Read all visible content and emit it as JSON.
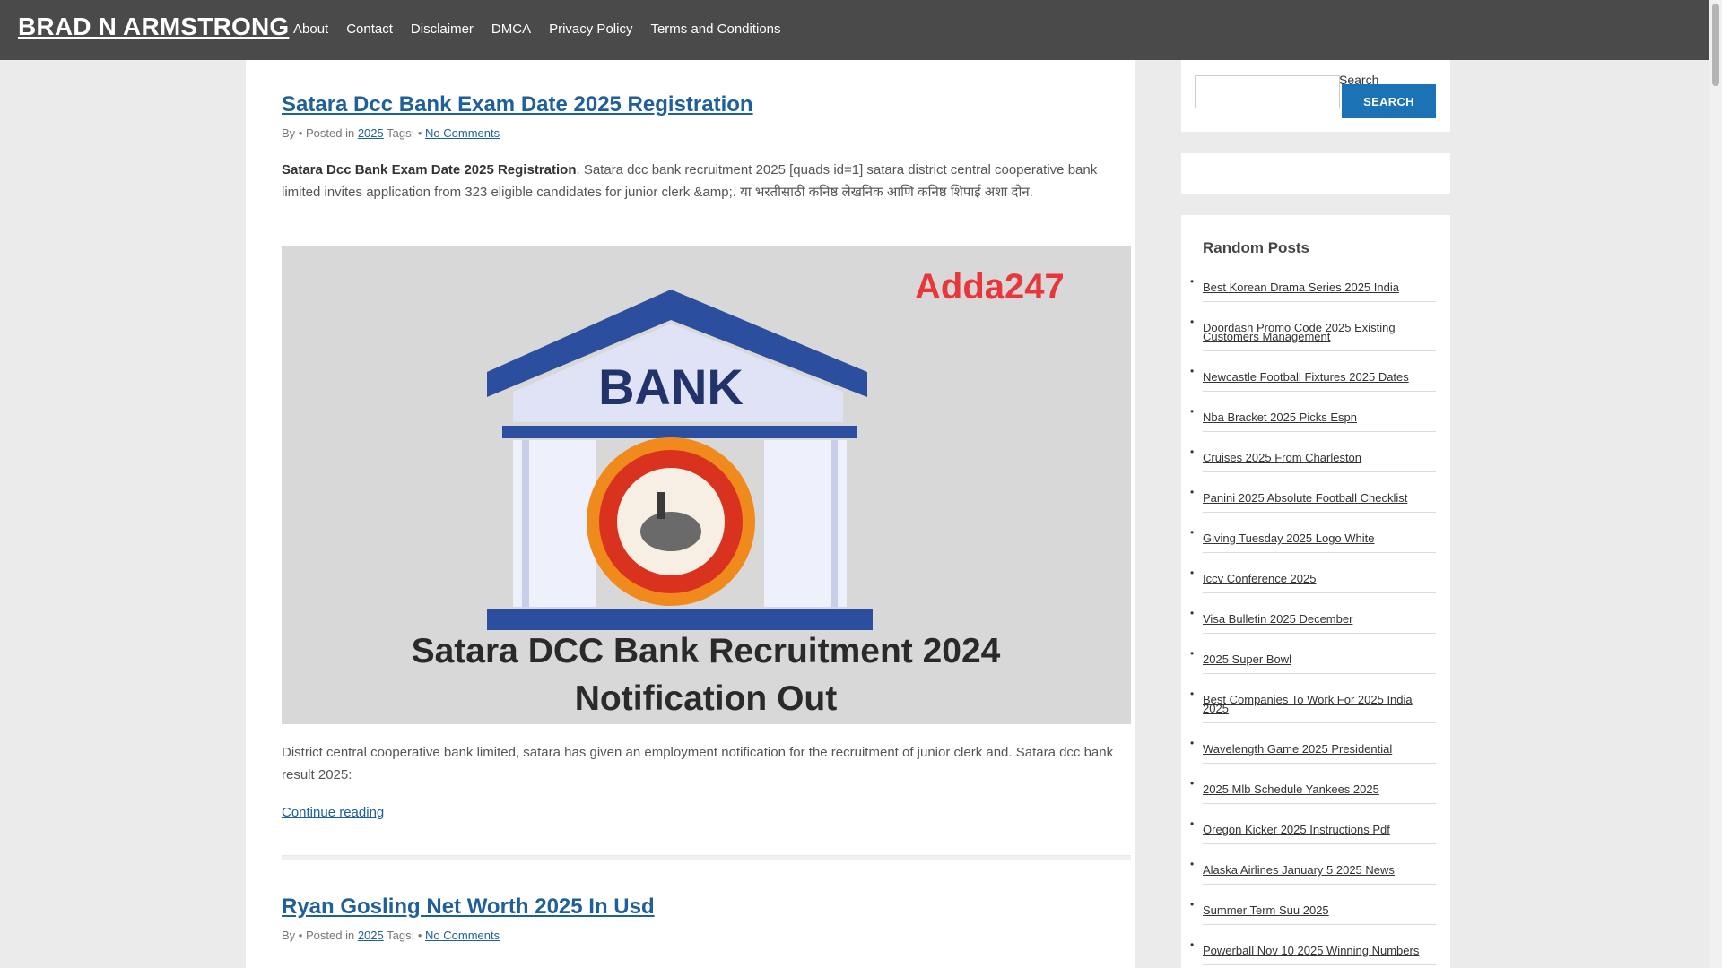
{
  "site": {
    "brand": "BRAD N ARMSTRONG",
    "nav": [
      "About",
      "Contact",
      "Disclaimer",
      "DMCA",
      "Privacy Policy",
      "Terms and Conditions"
    ]
  },
  "posts": [
    {
      "title": "Satara Dcc Bank Exam Date 2025 Registration",
      "meta": {
        "by": "By",
        "sep": "•",
        "posted_in": "Posted in",
        "category": "2025",
        "tags": "Tags:",
        "comments": "No Comments"
      },
      "excerpt_bold": "Satara Dcc Bank Exam Date 2025 Registration",
      "excerpt_rest": ". Satara dcc bank recruitment 2025 [quads id=1] satara district central cooperative bank limited invites application from 323 eligible candidates for junior clerk &amp;. या भरतीसाठी कनिष्ठ लेखनिक आणि कनिष्ठ शिपाई अशा दोन.",
      "image": {
        "logo": "Adda247",
        "bank_label": "BANK",
        "caption_line1": "Satara DCC Bank Recruitment 2024",
        "caption_line2": "Notification Out"
      },
      "after_text": "District central cooperative bank limited, satara has given an employment notification for the recruitment of junior clerk and. Satara dcc bank result 2025:",
      "continue": "Continue reading"
    },
    {
      "title": "Ryan Gosling Net Worth 2025 In Usd",
      "meta": {
        "by": "By",
        "sep": "•",
        "posted_in": "Posted in",
        "category": "2025",
        "tags": "Tags:",
        "comments": "No Comments"
      }
    }
  ],
  "sidebar": {
    "search_label": "Search",
    "search_button": "SEARCH",
    "search_value": "",
    "random_title": "Random Posts",
    "bullet": "•",
    "random_posts": [
      "Best Korean Drama Series 2025 India",
      "Doordash Promo Code 2025 Existing Customers Management",
      "Newcastle Football Fixtures 2025 Dates",
      "Nba Bracket 2025 Picks Espn",
      "Cruises 2025 From Charleston",
      "Panini 2025 Absolute Football Checklist",
      "Giving Tuesday 2025 Logo White",
      "Iccv Conference 2025",
      "Visa Bulletin 2025 December",
      "2025 Super Bowl",
      "Best Companies To Work For 2025 India 2025",
      "Wavelength Game 2025 Presidential",
      "2025 Mlb Schedule Yankees 2025",
      "Oregon Kicker 2025 Instructions Pdf",
      "Alaska Airlines January 5 2025 News",
      "Summer Term Suu 2025",
      "Powerball Nov 10 2025 Winning Numbers"
    ]
  },
  "colors": {
    "topbar": "#4a4a4a",
    "link": "#1f5f9a",
    "button": "#1b72b5",
    "bank_roof": "#2b4f9e",
    "seal_red": "#d9321f",
    "seal_orange": "#f08a1c",
    "logo_red": "#e8363b"
  }
}
